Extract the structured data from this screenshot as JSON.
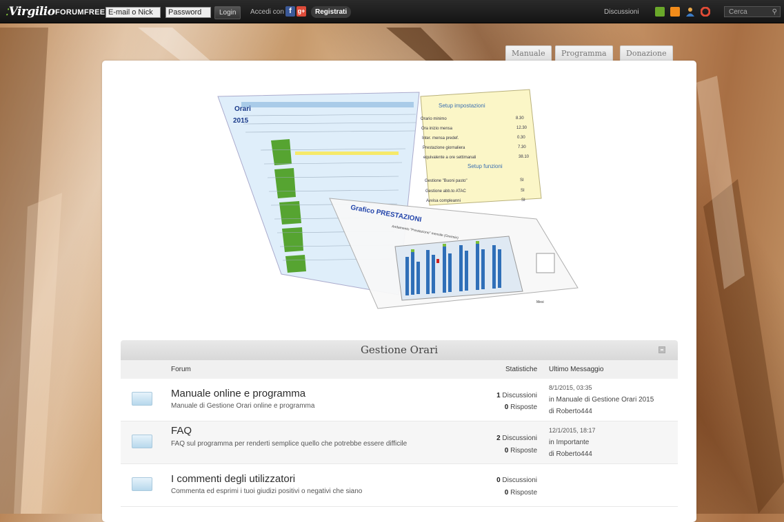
{
  "topbar": {
    "logo": "Virgilio",
    "logo_suffix": "FORUMFREE",
    "email_placeholder": "E-mail o Nick",
    "password_placeholder": "Password",
    "login_label": "Login",
    "accedi_label": "Accedi con",
    "facebook_glyph": "f",
    "google_glyph": "g+",
    "register_label": "Registrati",
    "discussioni_label": "Discussioni",
    "search_placeholder": "Cerca",
    "icons": [
      "forum-icon",
      "rss-icon",
      "users-icon",
      "help-icon",
      "search-icon"
    ]
  },
  "tabs": [
    "Manuale",
    "Programma",
    "Donazione"
  ],
  "category": {
    "title": "Gestione Orari",
    "headers": {
      "forum": "Forum",
      "stats": "Statistiche",
      "last": "Ultimo Messaggio"
    },
    "forums": [
      {
        "title": "Manuale online e programma",
        "desc": "Manuale di Gestione Orari online e programma",
        "discussioni_n": "1",
        "discussioni_label": "Discussioni",
        "risposte_n": "0",
        "risposte_label": "Risposte",
        "last_date": "8/1/2015, 03:35",
        "last_in": "in Manuale di Gestione Orari 2015",
        "last_by": "di Roberto444"
      },
      {
        "title": "FAQ",
        "desc": "FAQ sul programma per renderti semplice quello che potrebbe essere difficile",
        "discussioni_n": "2",
        "discussioni_label": "Discussioni",
        "risposte_n": "0",
        "risposte_label": "Risposte",
        "last_date": "12/1/2015, 18:17",
        "last_in": "in Importante",
        "last_by": "di Roberto444"
      },
      {
        "title": "I commenti degli utilizzatori",
        "desc": "Commenta ed esprimi i tuoi giudizi positivi o negativi che siano",
        "discussioni_n": "0",
        "discussioni_label": "Discussioni",
        "risposte_n": "0",
        "risposte_label": "Risposte"
      }
    ]
  },
  "banner": {
    "sheet_title": "Orari",
    "sheet_year": "2015",
    "setup_title": "Setup impostazioni",
    "setup_funzioni": "Setup funzioni",
    "setup_rows": [
      {
        "label": "Orario minimo",
        "value": "8.30"
      },
      {
        "label": "Ora inizio mensa",
        "value": "12.30"
      },
      {
        "label": "Inter. mensa predef.",
        "value": "0.30"
      },
      {
        "label": "Prestazione giornaliera",
        "value": "7.30"
      },
      {
        "label": "equivalente a ore settimanali",
        "value": "38.10"
      },
      {
        "label": "Gestione \"Buoni pasto\"",
        "value": "SI"
      },
      {
        "label": "Gestione abb.to ATAC",
        "value": "SI"
      },
      {
        "label": "Avvisa compleanni",
        "value": "SI"
      }
    ],
    "chart_title": "Grafico PRESTAZIONI",
    "chart_subtitle": "Andamento \"Prestazione\" mensile (Ore/min)",
    "chart_xlabel": "Mesi"
  }
}
